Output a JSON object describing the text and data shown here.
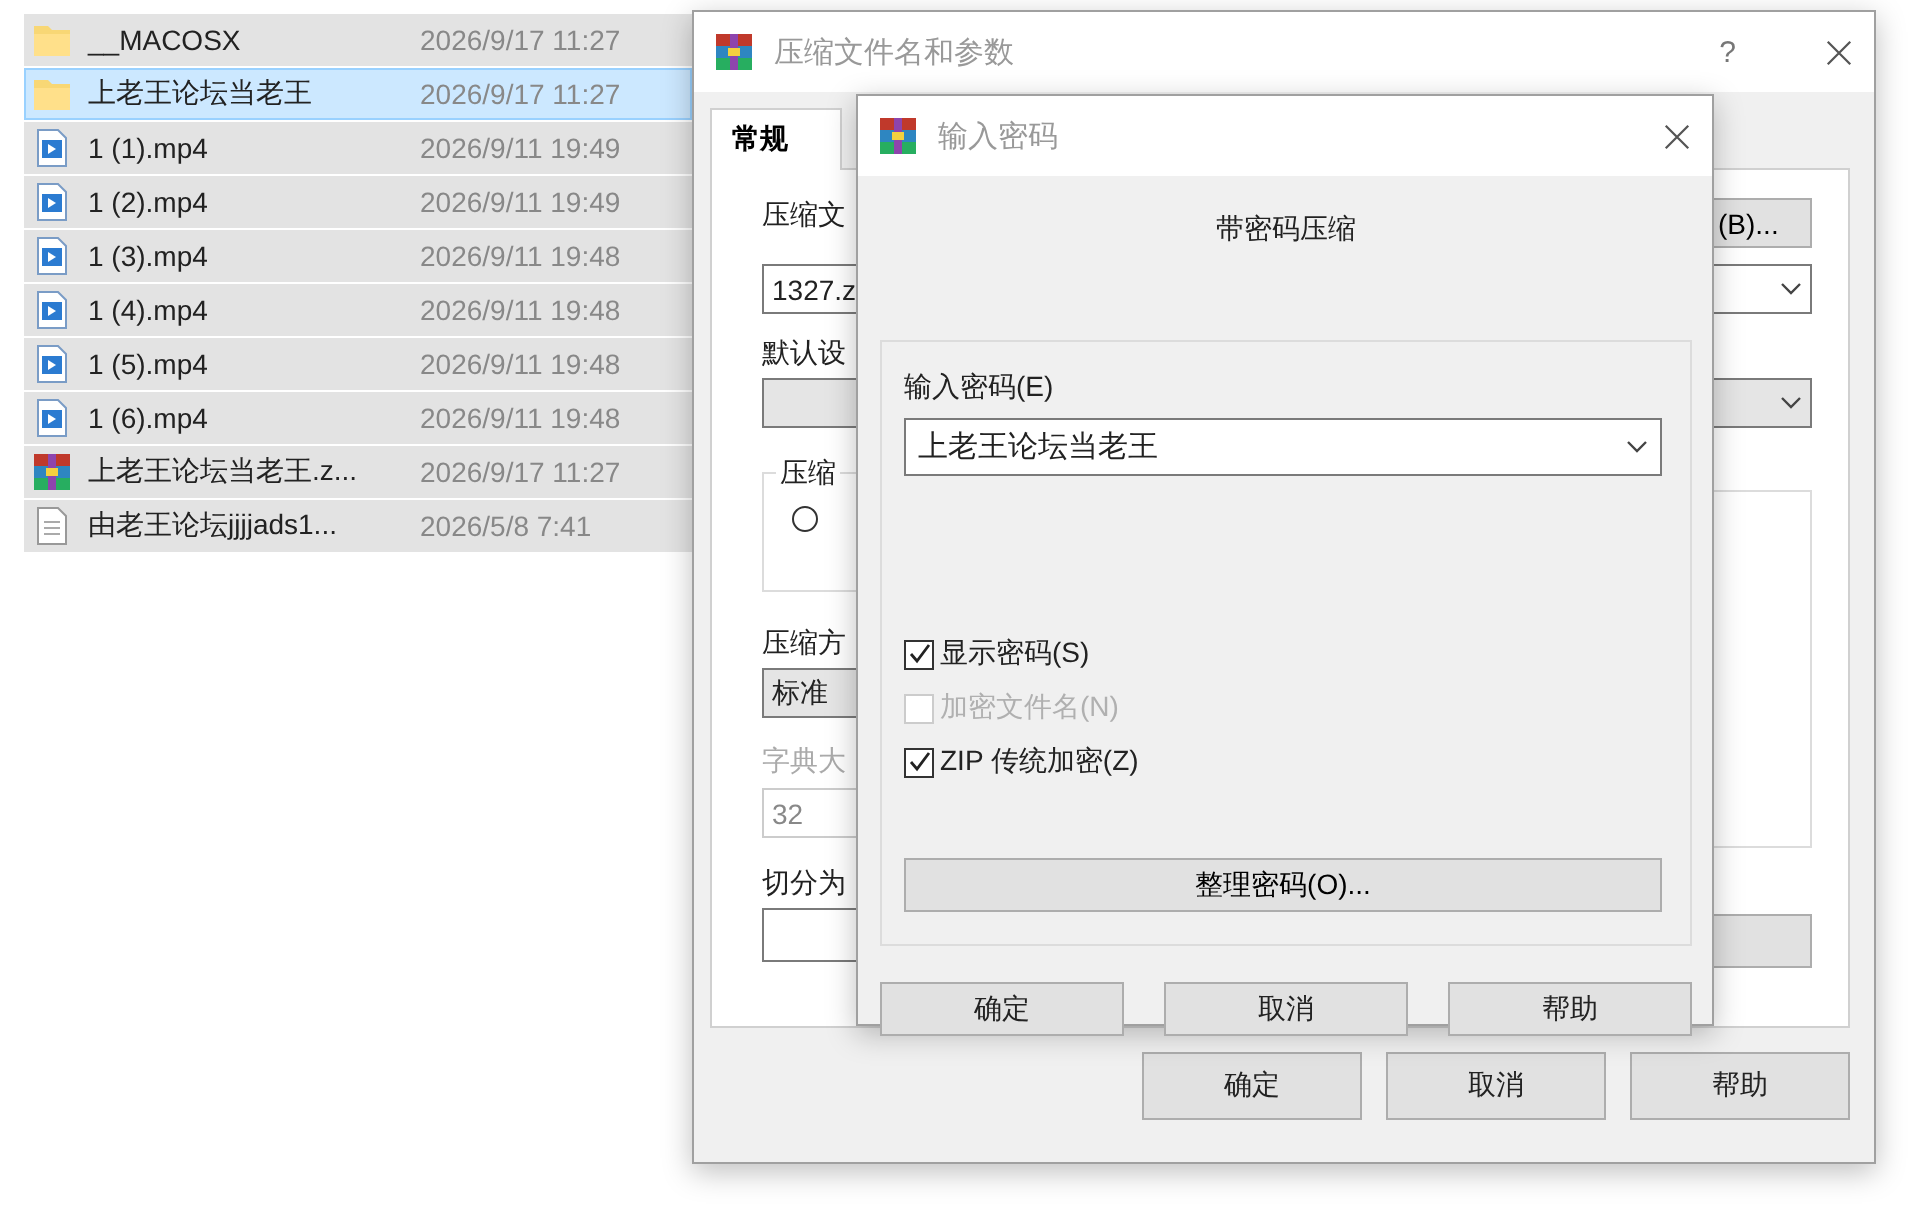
{
  "file_list": {
    "rows": [
      {
        "kind": "folder",
        "name": "__MACOSX",
        "modified": "2026/9/17 11:27",
        "selected": false
      },
      {
        "kind": "folder",
        "name": "上老王论坛当老王",
        "modified": "2026/9/17 11:27",
        "selected": true
      },
      {
        "kind": "video",
        "name": "1 (1).mp4",
        "modified": "2026/9/11 19:49",
        "selected": false
      },
      {
        "kind": "video",
        "name": "1 (2).mp4",
        "modified": "2026/9/11 19:49",
        "selected": false
      },
      {
        "kind": "video",
        "name": "1 (3).mp4",
        "modified": "2026/9/11 19:48",
        "selected": false
      },
      {
        "kind": "video",
        "name": "1 (4).mp4",
        "modified": "2026/9/11 19:48",
        "selected": false
      },
      {
        "kind": "video",
        "name": "1 (5).mp4",
        "modified": "2026/9/11 19:48",
        "selected": false
      },
      {
        "kind": "video",
        "name": "1 (6).mp4",
        "modified": "2026/9/11 19:48",
        "selected": false
      },
      {
        "kind": "archive",
        "name": "上老王论坛当老王.z...",
        "modified": "2026/9/17 11:27",
        "selected": false
      },
      {
        "kind": "text",
        "name": "由老王论坛jjjjads1...",
        "modified": "2026/5/8 7:41",
        "selected": false
      }
    ]
  },
  "compress_dialog": {
    "title": "压缩文件名和参数",
    "help_button": "?",
    "tabs": [
      {
        "label": "常规",
        "selected": true
      }
    ],
    "archive_name_label": "压缩文",
    "browse_button": "(B)...",
    "archive_name": "1327.z",
    "profile_label": "默认设",
    "group_label": "压缩",
    "radio_selected": false,
    "method_label": "压缩方",
    "method": "标准",
    "dictionary": {
      "label": "字典大",
      "value": "32",
      "disabled": true
    },
    "split_label": "切分为",
    "buttons": [
      "确定",
      "取消",
      "帮助"
    ]
  },
  "password_dialog": {
    "title": "输入密码",
    "heading": "带密码压缩",
    "password_label": "输入密码(E)",
    "password": "上老王论坛当老王",
    "options": [
      {
        "label": "显示密码(S)",
        "checked": true,
        "disabled": false
      },
      {
        "label": "加密文件名(N)",
        "checked": false,
        "disabled": true
      },
      {
        "label": "ZIP 传统加密(Z)",
        "checked": true,
        "disabled": false
      }
    ],
    "organize_button": "整理密码(O)...",
    "buttons": [
      "确定",
      "取消",
      "帮助"
    ]
  }
}
